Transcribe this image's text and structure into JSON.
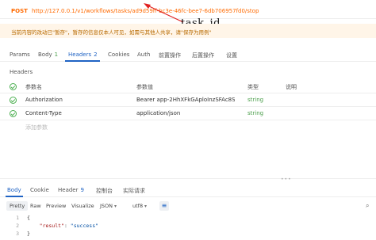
{
  "request": {
    "method": "POST",
    "url": "http://127.0.0.1/v1/workflows/tasks/ad9d59ff-bc3e-46fc-bee7-6db706957fd0/stop"
  },
  "annotation": {
    "label": "task_id"
  },
  "notice": {
    "text": "当前内容的改动已\"暂存\"，暂存的信息仅本人可见，如需与其他人共享，请\"保存为用例\""
  },
  "request_tabs": [
    {
      "label": "Params",
      "count": ""
    },
    {
      "label": "Body",
      "count": "1"
    },
    {
      "label": "Headers",
      "count": "2",
      "active": true
    },
    {
      "label": "Cookies",
      "count": ""
    },
    {
      "label": "Auth",
      "count": ""
    },
    {
      "label": "前置操作",
      "count": ""
    },
    {
      "label": "后置操作",
      "count": ""
    },
    {
      "label": "设置",
      "count": ""
    }
  ],
  "headers_section": {
    "label": "Headers"
  },
  "headers_table": {
    "columns": [
      "参数名",
      "参数值",
      "类型",
      "说明"
    ],
    "rows": [
      {
        "key": "Authorization",
        "value": "Bearer app-2HhXFkGAploInzSFAc8S9Z",
        "type": "string",
        "enabled": true
      },
      {
        "key": "Content-Type",
        "value": "application/json",
        "type": "string",
        "enabled": true
      }
    ],
    "add_placeholder": "添加参数"
  },
  "response_tabs": [
    {
      "label": "Body",
      "count": "",
      "active": true
    },
    {
      "label": "Cookie",
      "count": ""
    },
    {
      "label": "Header",
      "count": "9"
    },
    {
      "label": "控制台",
      "count": ""
    },
    {
      "label": "实际请求",
      "count": ""
    }
  ],
  "response_toolbar": {
    "views": [
      "Pretty",
      "Raw",
      "Preview",
      "Visualize"
    ],
    "format": "JSON",
    "encoding": "utf8"
  },
  "response_body": {
    "lines": [
      "{",
      "    \"result\": \"success\"",
      "}"
    ],
    "line_numbers": [
      "1",
      "2",
      "3"
    ],
    "key": "\"result\"",
    "value": "\"success\""
  },
  "colors": {
    "accent": "#1f63c4",
    "method": "#ff6a00",
    "notice_bg": "#fff5e8",
    "string_type": "#4a9e4a"
  },
  "icons": [
    "check-circle-icon",
    "wrap-lines-icon",
    "search-icon",
    "chevron-down-icon",
    "arrow-annotation-icon"
  ]
}
